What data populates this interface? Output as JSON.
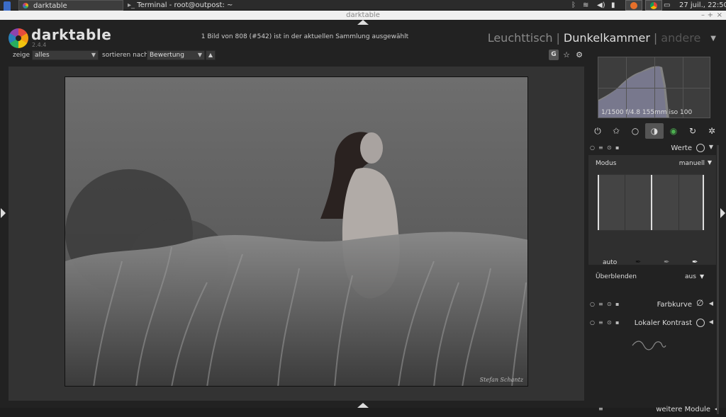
{
  "taskbar": {
    "app_task": "darktable",
    "terminal_task": "Terminal - root@outpost: ~",
    "clock": "27 juil., 22:50"
  },
  "window": {
    "title": "darktable"
  },
  "header": {
    "app_name": "darktable",
    "version": "2.4.4",
    "collection_info": "1 Bild von 808 (#542) ist in der aktuellen Sammlung ausgewählt",
    "views": {
      "lighttable": "Leuchttisch",
      "darkroom": "Dunkelkammer",
      "other": "andere"
    }
  },
  "filter": {
    "show_label": "zeige",
    "show_value": "alles",
    "sort_label": "sortieren nach",
    "sort_value": "Bewertung"
  },
  "top_icons": {
    "g_label": "G"
  },
  "image": {
    "signature": "Stefan Schantz"
  },
  "histogram": {
    "exif": "1/1500 f/4.8 155mm iso 100"
  },
  "modules": {
    "levels": {
      "name": "Werte",
      "mode_label": "Modus",
      "mode_value": "manuell",
      "auto_label": "auto",
      "blend_label": "Überblenden",
      "blend_value": "aus"
    },
    "curve": {
      "name": "Farbkurve"
    },
    "local_contrast": {
      "name": "Lokaler Kontrast"
    },
    "more": "weitere Module"
  },
  "icons": {
    "module_groups": [
      "power-icon",
      "star-icon",
      "circle-icon",
      "half-circle-icon",
      "color-icon",
      "correction-icon",
      "effect-icon"
    ]
  }
}
